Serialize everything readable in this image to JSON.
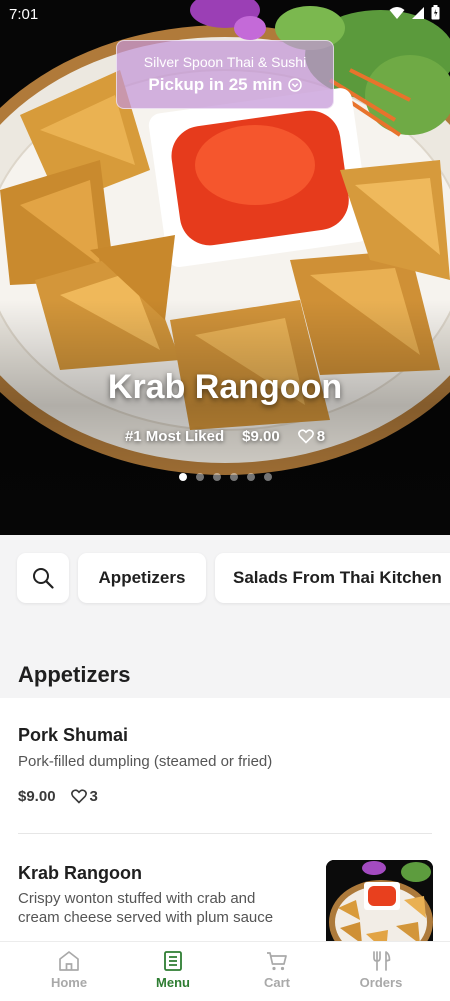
{
  "status_bar": {
    "time": "7:01"
  },
  "restaurant": {
    "name": "Silver Spoon Thai & Sushi",
    "pickup": "Pickup in 25 min"
  },
  "featured": {
    "title": "Krab Rangoon",
    "badge": "#1 Most Liked",
    "price": "$9.00",
    "likes": "8",
    "carousel_pages": 6,
    "carousel_active": 1
  },
  "categories": {
    "items": [
      "Appetizers",
      "Salads From Thai Kitchen"
    ]
  },
  "section": {
    "title": "Appetizers"
  },
  "menu_items": [
    {
      "name": "Pork Shumai",
      "description": "Pork-filled dumpling (steamed or fried)",
      "price": "$9.00",
      "likes": "3"
    },
    {
      "name": "Krab Rangoon",
      "description": "Crispy wonton stuffed with crab and cream cheese served with plum sauce"
    }
  ],
  "bottom_nav": {
    "items": [
      "Home",
      "Menu",
      "Cart",
      "Orders"
    ],
    "active": "Menu"
  },
  "colors": {
    "accent": "#2e7d32",
    "pill_bg": "#c396d7"
  },
  "icons": [
    "wifi-icon",
    "signal-icon",
    "battery-icon",
    "chevron-down-circle-icon",
    "heart-icon",
    "search-icon",
    "home-icon",
    "menu-book-icon",
    "cart-icon",
    "fork-knife-icon"
  ]
}
